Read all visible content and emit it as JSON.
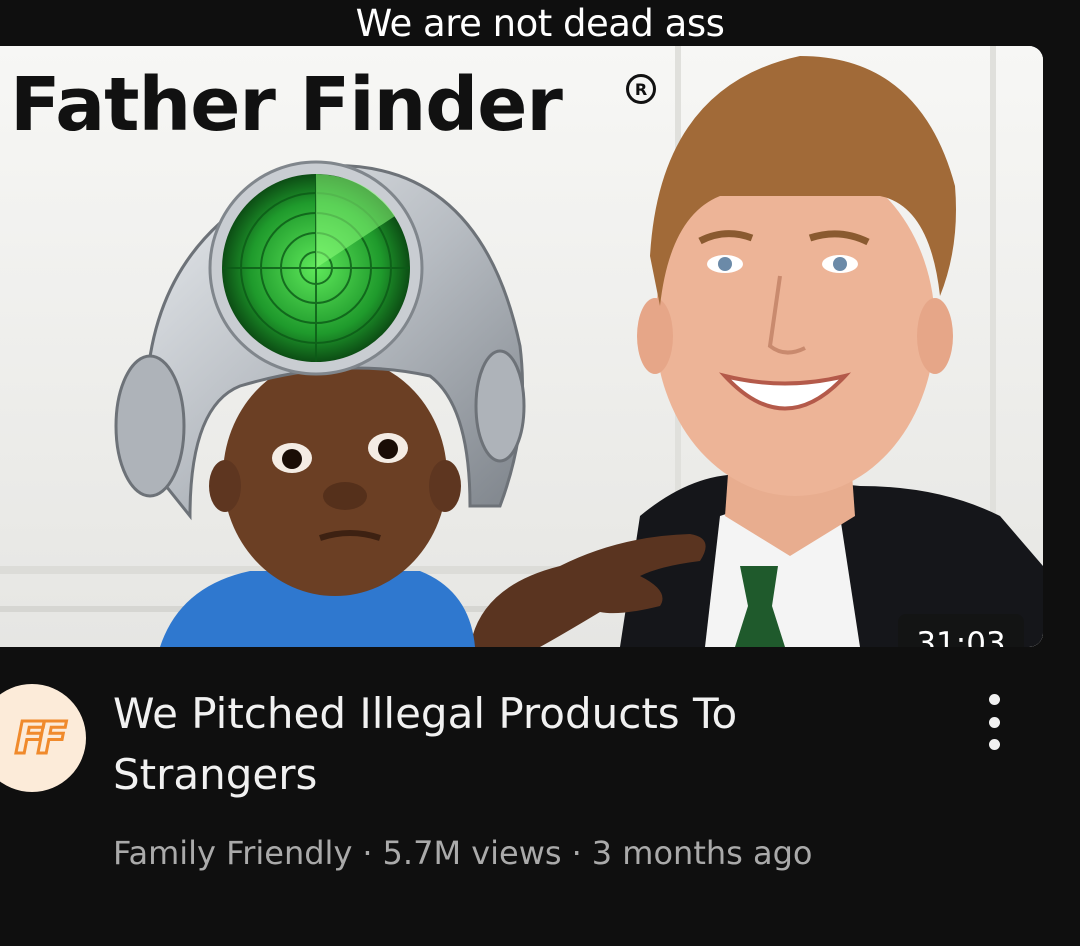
{
  "overlay_caption": "We are not dead ass",
  "thumbnail": {
    "title_text": "Father Finder",
    "reg_symbol": "R",
    "duration": "31:03"
  },
  "channel": {
    "avatar_letters": "FF",
    "avatar_bg": "#fcebd9",
    "avatar_accent": "#f08a2c"
  },
  "video": {
    "title": "We Pitched Illegal Products To Strangers",
    "channel_name": "Family Friendly",
    "views": "5.7M views",
    "age": "3 months ago",
    "separator": "·"
  },
  "icons": {
    "more": "more-vertical-icon"
  }
}
